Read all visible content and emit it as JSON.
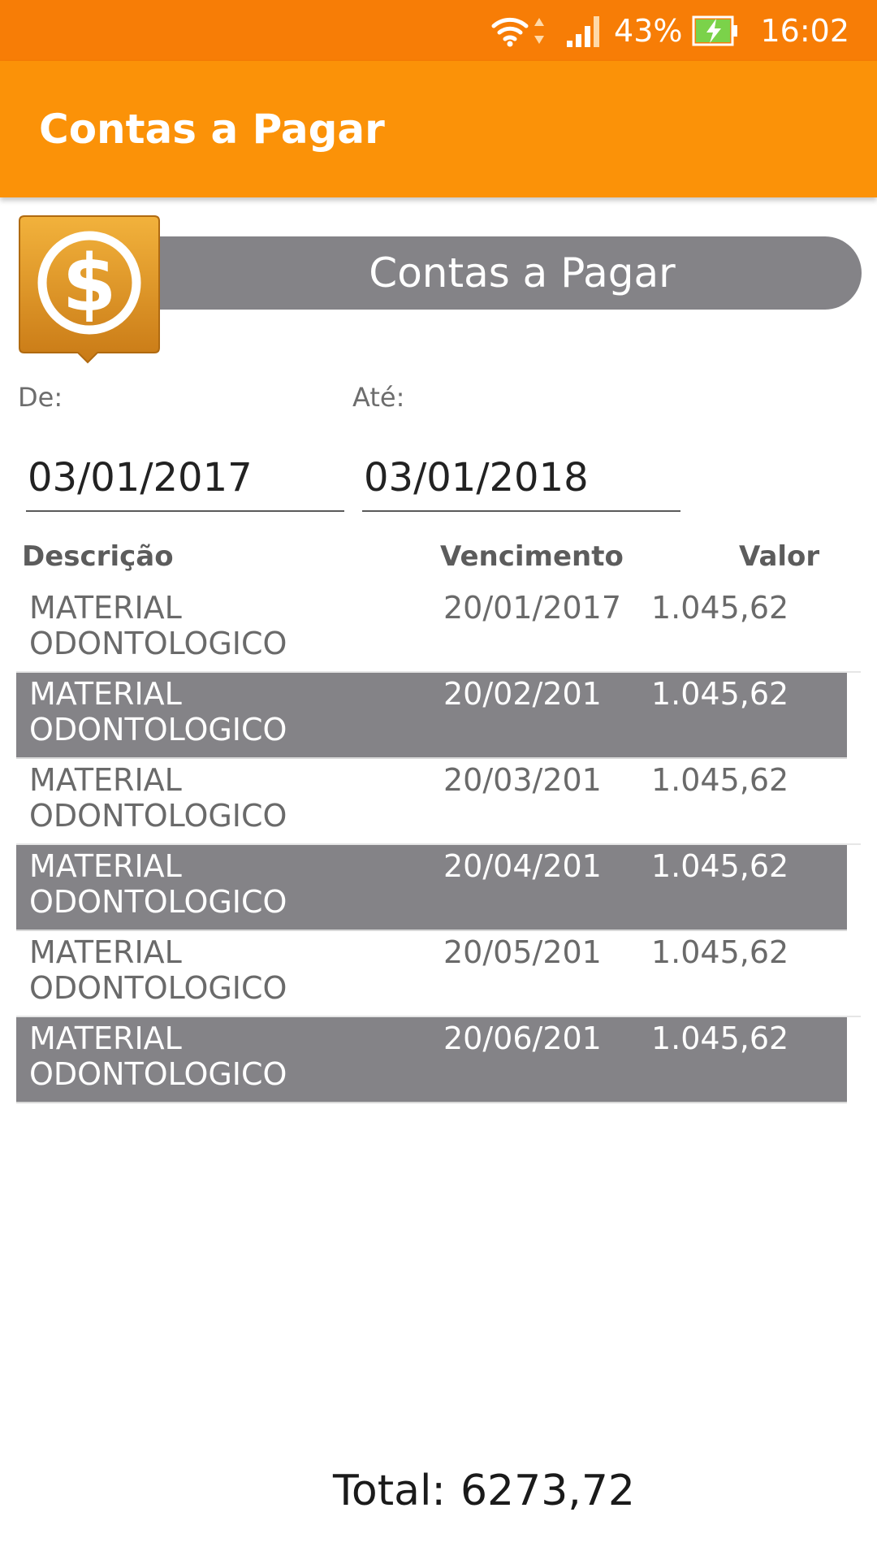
{
  "status_bar": {
    "battery_percent": "43%",
    "time": "16:02"
  },
  "app_bar": {
    "title": "Contas a Pagar"
  },
  "banner": {
    "title": "Contas a Pagar",
    "icon": "dollar-icon"
  },
  "filters": {
    "from_label": "De:",
    "from_value": "03/01/2017",
    "to_label": "Até:",
    "to_value": "03/01/2018"
  },
  "table": {
    "headers": {
      "descricao": "Descrição",
      "vencimento": "Vencimento",
      "valor": "Valor"
    },
    "rows": [
      {
        "desc_line1": "MATERIAL",
        "desc_line2": "ODONTOLOGICO",
        "vencimento": "20/01/2017",
        "valor": "1.045,62"
      },
      {
        "desc_line1": "MATERIAL",
        "desc_line2": "ODONTOLOGICO",
        "vencimento": "20/02/201",
        "valor": "1.045,62"
      },
      {
        "desc_line1": "MATERIAL",
        "desc_line2": "ODONTOLOGICO",
        "vencimento": "20/03/201",
        "valor": "1.045,62"
      },
      {
        "desc_line1": "MATERIAL",
        "desc_line2": "ODONTOLOGICO",
        "vencimento": "20/04/201",
        "valor": "1.045,62"
      },
      {
        "desc_line1": "MATERIAL",
        "desc_line2": "ODONTOLOGICO",
        "vencimento": "20/05/201",
        "valor": "1.045,62"
      },
      {
        "desc_line1": "MATERIAL",
        "desc_line2": "ODONTOLOGICO",
        "vencimento": "20/06/201",
        "valor": "1.045,62"
      }
    ]
  },
  "total": {
    "label": "Total:",
    "value": "6273,72"
  },
  "colors": {
    "status_bar": "#f77d06",
    "app_bar": "#fb9208",
    "banner": "#848387",
    "row_alt": "#848387",
    "icon_gold": "#d88a1a"
  }
}
